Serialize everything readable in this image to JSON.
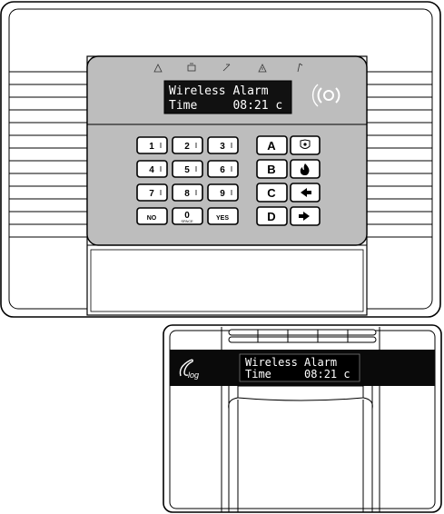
{
  "upper_unit": {
    "display": {
      "line1": "Wireless Alarm",
      "line2": "Time     08:21 c"
    },
    "keypad": {
      "numeric_keys": [
        {
          "label": "1"
        },
        {
          "label": "2"
        },
        {
          "label": "3"
        },
        {
          "label": "4"
        },
        {
          "label": "5"
        },
        {
          "label": "6"
        },
        {
          "label": "7"
        },
        {
          "label": "8"
        },
        {
          "label": "9"
        },
        {
          "label": "NO"
        },
        {
          "label": "0"
        },
        {
          "label": "YES"
        }
      ],
      "zero_sub": "SPACE",
      "letter_keys": [
        {
          "label": "A"
        },
        {
          "label": "B"
        },
        {
          "label": "C"
        },
        {
          "label": "D"
        }
      ],
      "function_icons": [
        "police-icon",
        "fire-icon",
        "arrow-left-icon",
        "arrow-right-icon"
      ]
    },
    "status_icons": [
      "warning-icon",
      "tamper-icon",
      "setting-icon",
      "fault-icon",
      "power-icon"
    ]
  },
  "lower_unit": {
    "logo": "log",
    "display": {
      "line1": "Wireless Alarm",
      "line2": "Time     08:21 c"
    }
  }
}
